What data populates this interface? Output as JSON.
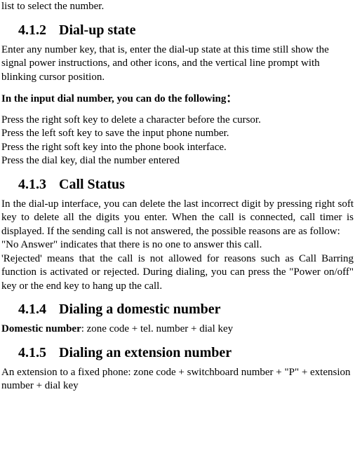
{
  "top_fragment": "list to select the number.",
  "sec_412": {
    "num": "4.1.2",
    "title": "Dial-up state",
    "intro": "Enter any number key, that is, enter the dial-up state at this time still show the signal power instructions, and other icons, and the vertical line prompt with blinking cursor position.",
    "bold_line": "In the input dial number, you can do the following：",
    "actions": {
      "a1": "Press the right soft key to delete a character before the cursor.",
      "a2": "Press the left soft key to save the input phone number.",
      "a3": "Press the right soft key into the phone book interface.",
      "a4": "Press the dial key, dial the number entered"
    }
  },
  "sec_413": {
    "num": "4.1.3",
    "title": "Call Status",
    "para1": "In the dial-up interface, you can delete the last incorrect digit by pressing right soft key to delete all the digits you enter. When the call is connected, call timer is displayed. If the sending call is not answered, the possible reasons are as follow:",
    "para2": "\"No Answer\" indicates that there is no one to answer this call.",
    "para3": "'Rejected' means that the call is not allowed for reasons such as Call Barring function is activated or rejected. During dialing, you can press the \"Power on/off\" key or the end key to hang up the call."
  },
  "sec_414": {
    "num": "4.1.4",
    "title": "Dialing a domestic number",
    "line_prefix": "Domestic number",
    "line_suffix": ": zone code + tel. number + dial key"
  },
  "sec_415": {
    "num": "4.1.5",
    "title": "Dialing an extension number",
    "para": "An extension to a fixed phone: zone code + switchboard number + \"P\" + extension number + dial key"
  }
}
